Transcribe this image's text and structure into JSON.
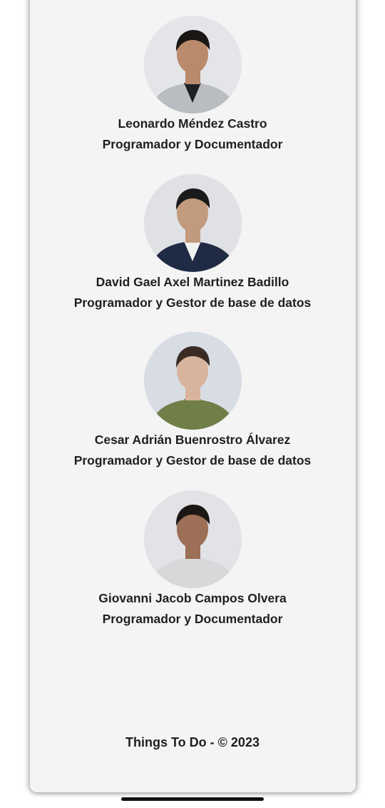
{
  "team": [
    {
      "name": "Leonardo Méndez Castro",
      "role": "Programador y Documentador",
      "photo_icon": "portrait-icon",
      "shirt_color": "#b9bcc0",
      "hair_color": "#1a1614",
      "skin_color": "#b98a6c",
      "inner_color": "#1e1f22",
      "bg_color": "#e4e5e8"
    },
    {
      "name": "David Gael Axel Martinez Badillo",
      "role": "Programador y Gestor de base de datos",
      "photo_icon": "portrait-icon",
      "shirt_color": "#1f2a44",
      "hair_color": "#1a1a1a",
      "skin_color": "#c29a7d",
      "inner_color": "#f2f2f2",
      "bg_color": "#dfe1e5"
    },
    {
      "name": "Cesar Adrián Buenrostro Álvarez",
      "role": "Programador y Gestor de base de datos",
      "photo_icon": "portrait-icon",
      "shirt_color": "#6f7f47",
      "hair_color": "#3a2c25",
      "skin_color": "#d8b49d",
      "inner_color": "#6f7f47",
      "bg_color": "#d8dde4"
    },
    {
      "name": "Giovanni Jacob Campos Olvera",
      "role": "Programador y Documentador",
      "photo_icon": "portrait-icon",
      "shirt_color": "#d6d8da",
      "hair_color": "#1b1715",
      "skin_color": "#9c6f56",
      "inner_color": "#d6d8da",
      "bg_color": "#e2e3e6"
    }
  ],
  "footer": {
    "text": "Things To Do - © 2023"
  }
}
